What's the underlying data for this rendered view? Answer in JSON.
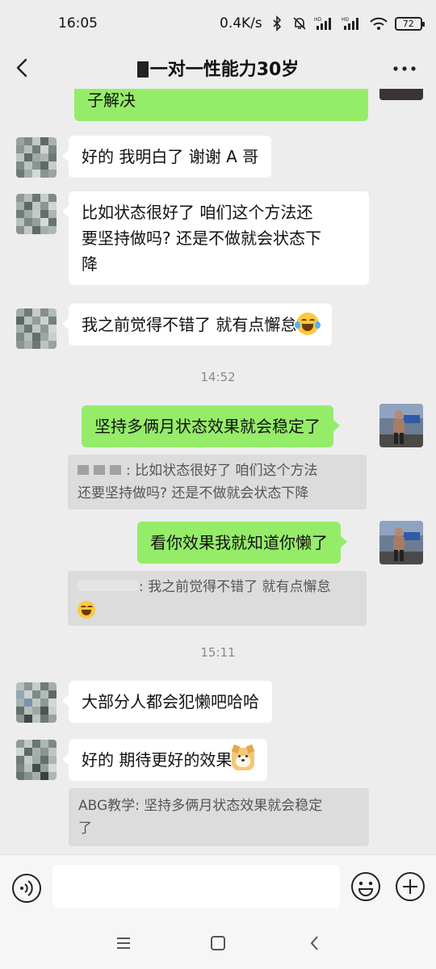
{
  "status_bar": {
    "time": "16:05",
    "network_speed": "0.4K/s",
    "battery": "72"
  },
  "header": {
    "title": "一对一性能力30岁"
  },
  "messages": {
    "partial_top": "子解决",
    "m1": "好的 我明白了 谢谢 A 哥",
    "m2_line1": "比如状态很好了 咱们这个方法还",
    "m2_line2": "要坚持做吗? 还是不做就会状态下",
    "m2_line3": "降",
    "m3": "我之前觉得不错了 就有点懈怠",
    "time1": "14:52",
    "m4": "坚持多俩月状态效果就会稳定了",
    "q1_line1": ": 比如状态很好了 咱们这个方法",
    "q1_line2": "还要坚持做吗? 还是不做就会状态下降",
    "m5": "看你效果我就知道你懒了",
    "q2_line1": ": 我之前觉得不错了 就有点懈怠",
    "time2": "15:11",
    "m6": "大部分人都会犯懒吧哈哈",
    "m7": "好的 期待更好的效果",
    "q3_line1": "ABG教学: 坚持多俩月状态效果就会稳定",
    "q3_line2": "了"
  },
  "input": {
    "placeholder": ""
  },
  "icons": {
    "back": "chevron-left-icon",
    "more": "more-dots-icon",
    "voice": "voice-icon",
    "emoji": "emoji-face-icon",
    "plus": "plus-circle-icon",
    "nav_menu": "menu-icon",
    "nav_home": "home-square-icon",
    "nav_back": "nav-back-icon"
  },
  "colors": {
    "chat_background": "#ededed",
    "sent_bubble": "#95ec69",
    "received_bubble": "#ffffff",
    "quote_background": "#dcdcdc"
  }
}
